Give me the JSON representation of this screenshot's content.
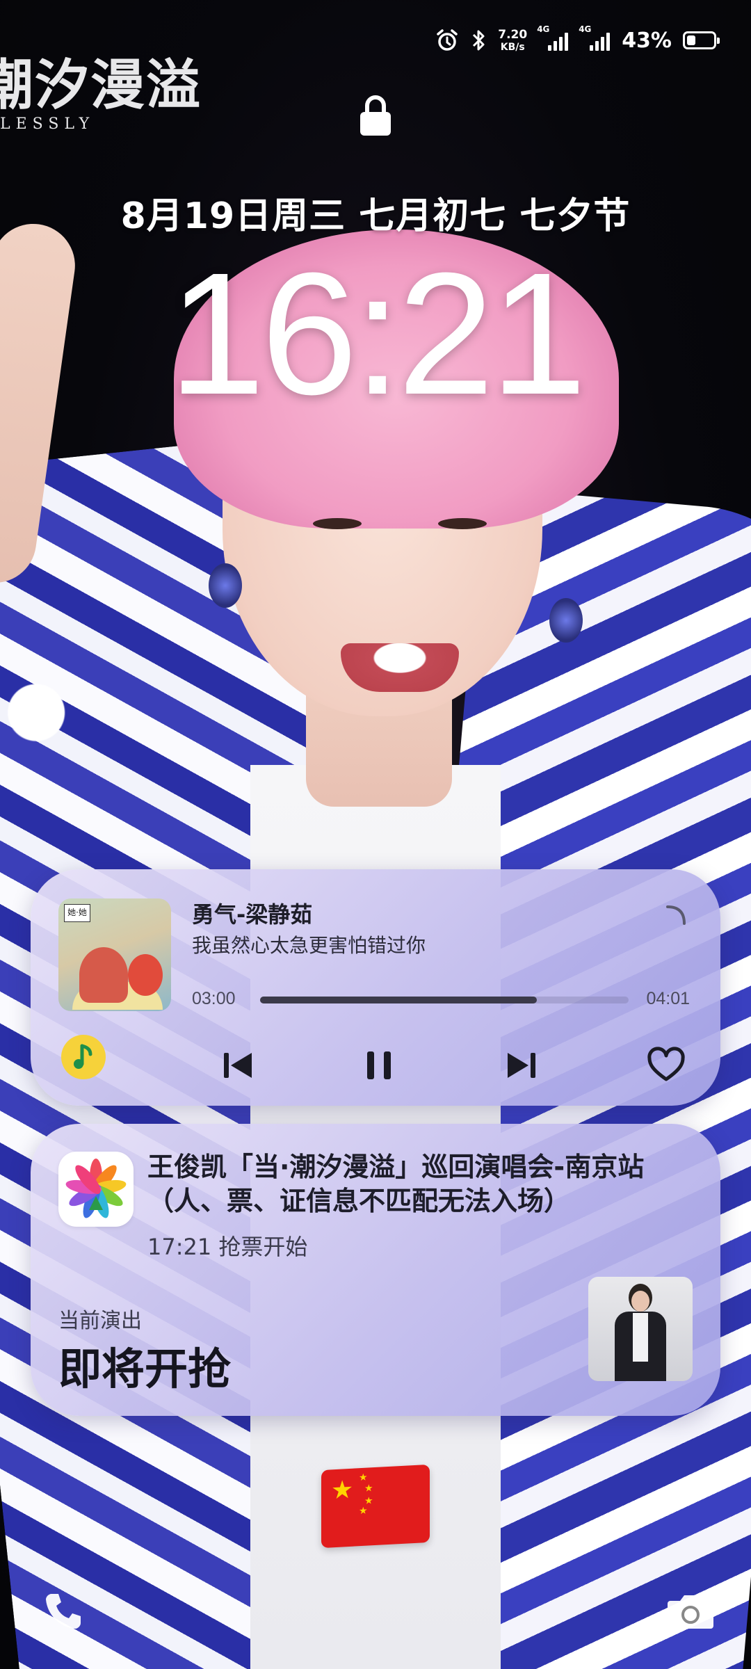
{
  "wallpaper": {
    "logo_text": "潮汐漫溢",
    "logo_subtitle": "LESSLY"
  },
  "status_bar": {
    "icons": [
      "alarm-icon",
      "bluetooth-icon"
    ],
    "net_speed_value": "7.20",
    "net_speed_unit": "KB/s",
    "sim1_label": "4G",
    "sim2_label": "4G",
    "battery_text": "43%",
    "battery_level": 0.43
  },
  "lockscreen": {
    "date_text": "8月19日周三  七月初七 七夕节",
    "time_text": "16:21"
  },
  "music_card": {
    "song_title": "勇气-梁静茹",
    "lyric": "我虽然心太急更害怕错过你",
    "time_current": "03:00",
    "time_total": "04:01",
    "progress": 0.75,
    "album_tag": "她·她",
    "controls": [
      "qq-music-icon",
      "previous-icon",
      "pause-icon",
      "next-icon",
      "heart-icon"
    ]
  },
  "event_card": {
    "title": "王俊凯「当·潮汐漫溢」巡回演唱会-南京站（人、票、证信息不匹配无法入场）",
    "subtitle": "17:21 抢票开始",
    "current_label": "当前演出",
    "current_status": "即将开抢"
  },
  "bottom": {
    "flag_emoji_name": "china-flag",
    "left_shortcut": "phone-icon",
    "right_shortcut": "camera-icon"
  },
  "colors": {
    "card_tint": "#c8c2f0",
    "progress_fill": "#3b3a4a",
    "qq_yellow": "#f6d23a",
    "flag_red": "#e11c1c"
  }
}
